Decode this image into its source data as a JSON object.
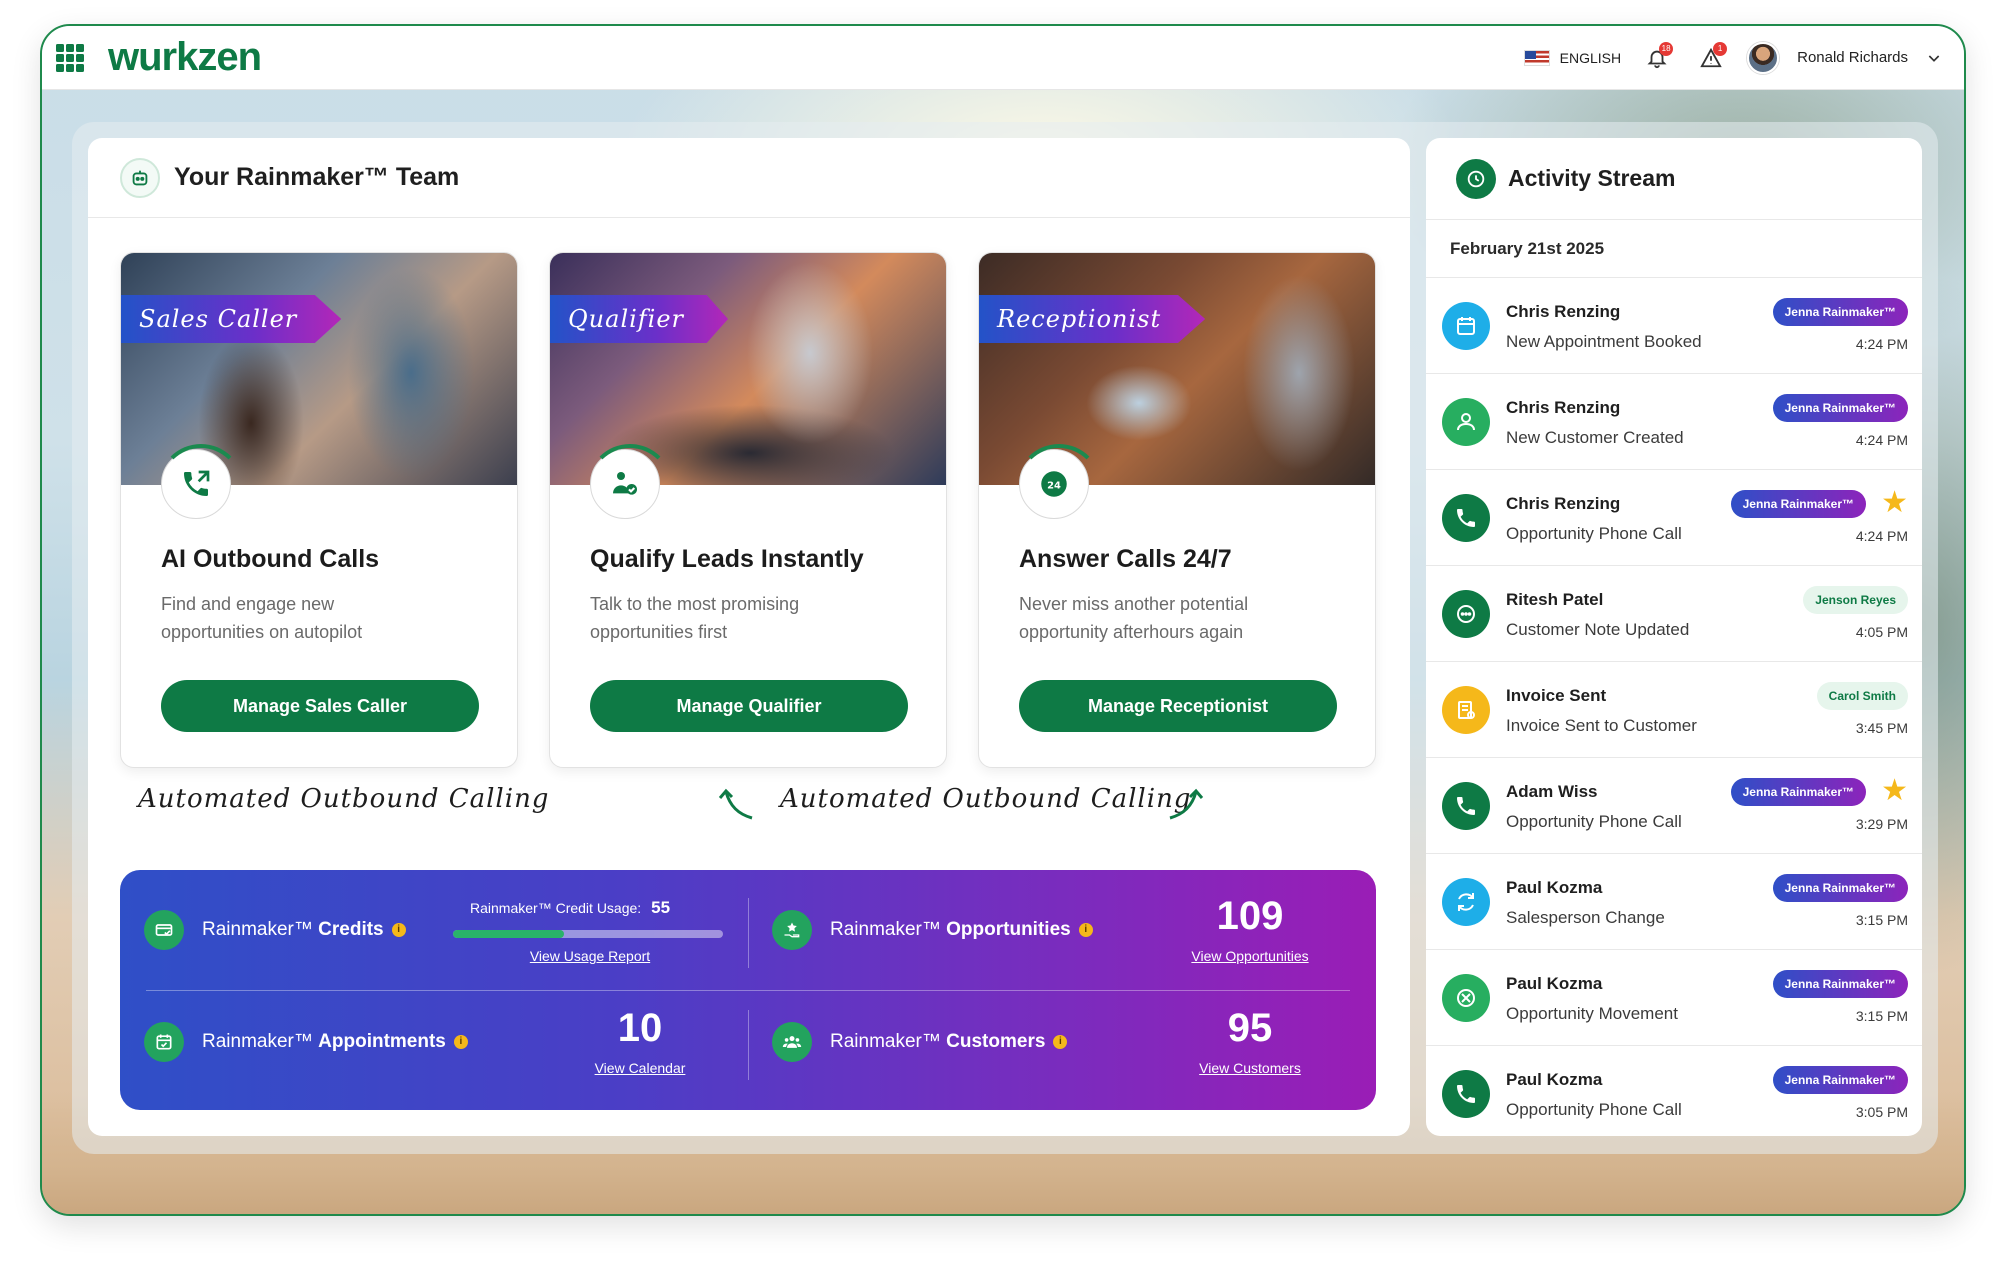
{
  "topbar": {
    "logo": "wurkzen",
    "language": "ENGLISH",
    "notifications_count": "18",
    "alerts_count": "1",
    "user_name": "Ronald Richards"
  },
  "main": {
    "title": "Your Rainmaker™ Team",
    "cards": [
      {
        "tag": "Sales Caller",
        "title": "AI Outbound Calls",
        "desc_line1": "Find and engage new",
        "desc_line2": "opportunities on autopilot",
        "button": "Manage Sales Caller"
      },
      {
        "tag": "Qualifier",
        "title": "Qualify Leads Instantly",
        "desc_line1": "Talk to the most promising",
        "desc_line2": "opportunities first",
        "button": "Manage Qualifier"
      },
      {
        "tag": "Receptionist",
        "title": "Answer Calls 24/7",
        "desc_line1": "Never miss another potential",
        "desc_line2": "opportunity afterhours again",
        "button": "Manage Receptionist"
      }
    ],
    "script_label_1": "Automated Outbound Calling",
    "script_label_2": "Automated Outbound Calling"
  },
  "stats": {
    "credits": {
      "label_prefix": "Rainmaker™",
      "label_bold": "Credits",
      "usage_label": "Rainmaker™ Credit Usage:",
      "usage_value": "55",
      "usage_fraction": 0.41,
      "link": "View Usage Report"
    },
    "opportunities": {
      "label_prefix": "Rainmaker™",
      "label_bold": "Opportunities",
      "value": "109",
      "link": "View Opportunities"
    },
    "appointments": {
      "label_prefix": "Rainmaker™",
      "label_bold": "Appointments",
      "value": "10",
      "link": "View Calendar"
    },
    "customers": {
      "label_prefix": "Rainmaker™",
      "label_bold": "Customers",
      "value": "95",
      "link": "View Customers"
    }
  },
  "activity": {
    "title": "Activity Stream",
    "date": "February 21st 2025",
    "items": [
      {
        "name": "Chris Renzing",
        "desc": "New Appointment Booked",
        "tag": "Jenna Rainmaker™",
        "time": "4:24 PM",
        "icon": "calendar-icon",
        "color": "#1eaee8"
      },
      {
        "name": "Chris Renzing",
        "desc": "New Customer Created",
        "tag": "Jenna Rainmaker™",
        "time": "4:24 PM",
        "icon": "user-icon",
        "color": "#27ae60"
      },
      {
        "name": "Chris Renzing",
        "desc": "Opportunity Phone Call",
        "tag": "Jenna Rainmaker™",
        "time": "4:24 PM",
        "icon": "phone-incoming-icon",
        "color": "#0e7a45"
      },
      {
        "name": "Ritesh Patel",
        "desc": "Customer Note Updated",
        "tag": "Jenson Reyes",
        "time": "4:05 PM",
        "icon": "chat-bubble-icon",
        "color": "#0e7a45"
      },
      {
        "name": "Invoice Sent",
        "desc": "Invoice Sent to Customer",
        "tag": "Carol Smith",
        "time": "3:45 PM",
        "icon": "invoice-icon",
        "color": "#f5b81a"
      },
      {
        "name": "Adam Wiss",
        "desc": "Opportunity Phone Call",
        "tag": "Jenna Rainmaker™",
        "time": "3:29 PM",
        "icon": "phone-incoming-icon",
        "color": "#0e7a45"
      },
      {
        "name": "Paul Kozma",
        "desc": "Salesperson Change",
        "tag": "Jenna Rainmaker™",
        "time": "3:15 PM",
        "icon": "refresh-icon",
        "color": "#1eaee8"
      },
      {
        "name": "Paul Kozma",
        "desc": "Opportunity Movement",
        "tag": "Jenna Rainmaker™",
        "time": "3:15 PM",
        "icon": "move-arrows-icon",
        "color": "#27ae60"
      },
      {
        "name": "Paul Kozma",
        "desc": "Opportunity Phone Call",
        "tag": "Jenna Rainmaker™",
        "time": "3:05 PM",
        "icon": "phone-incoming-icon",
        "color": "#0e7a45"
      }
    ]
  }
}
